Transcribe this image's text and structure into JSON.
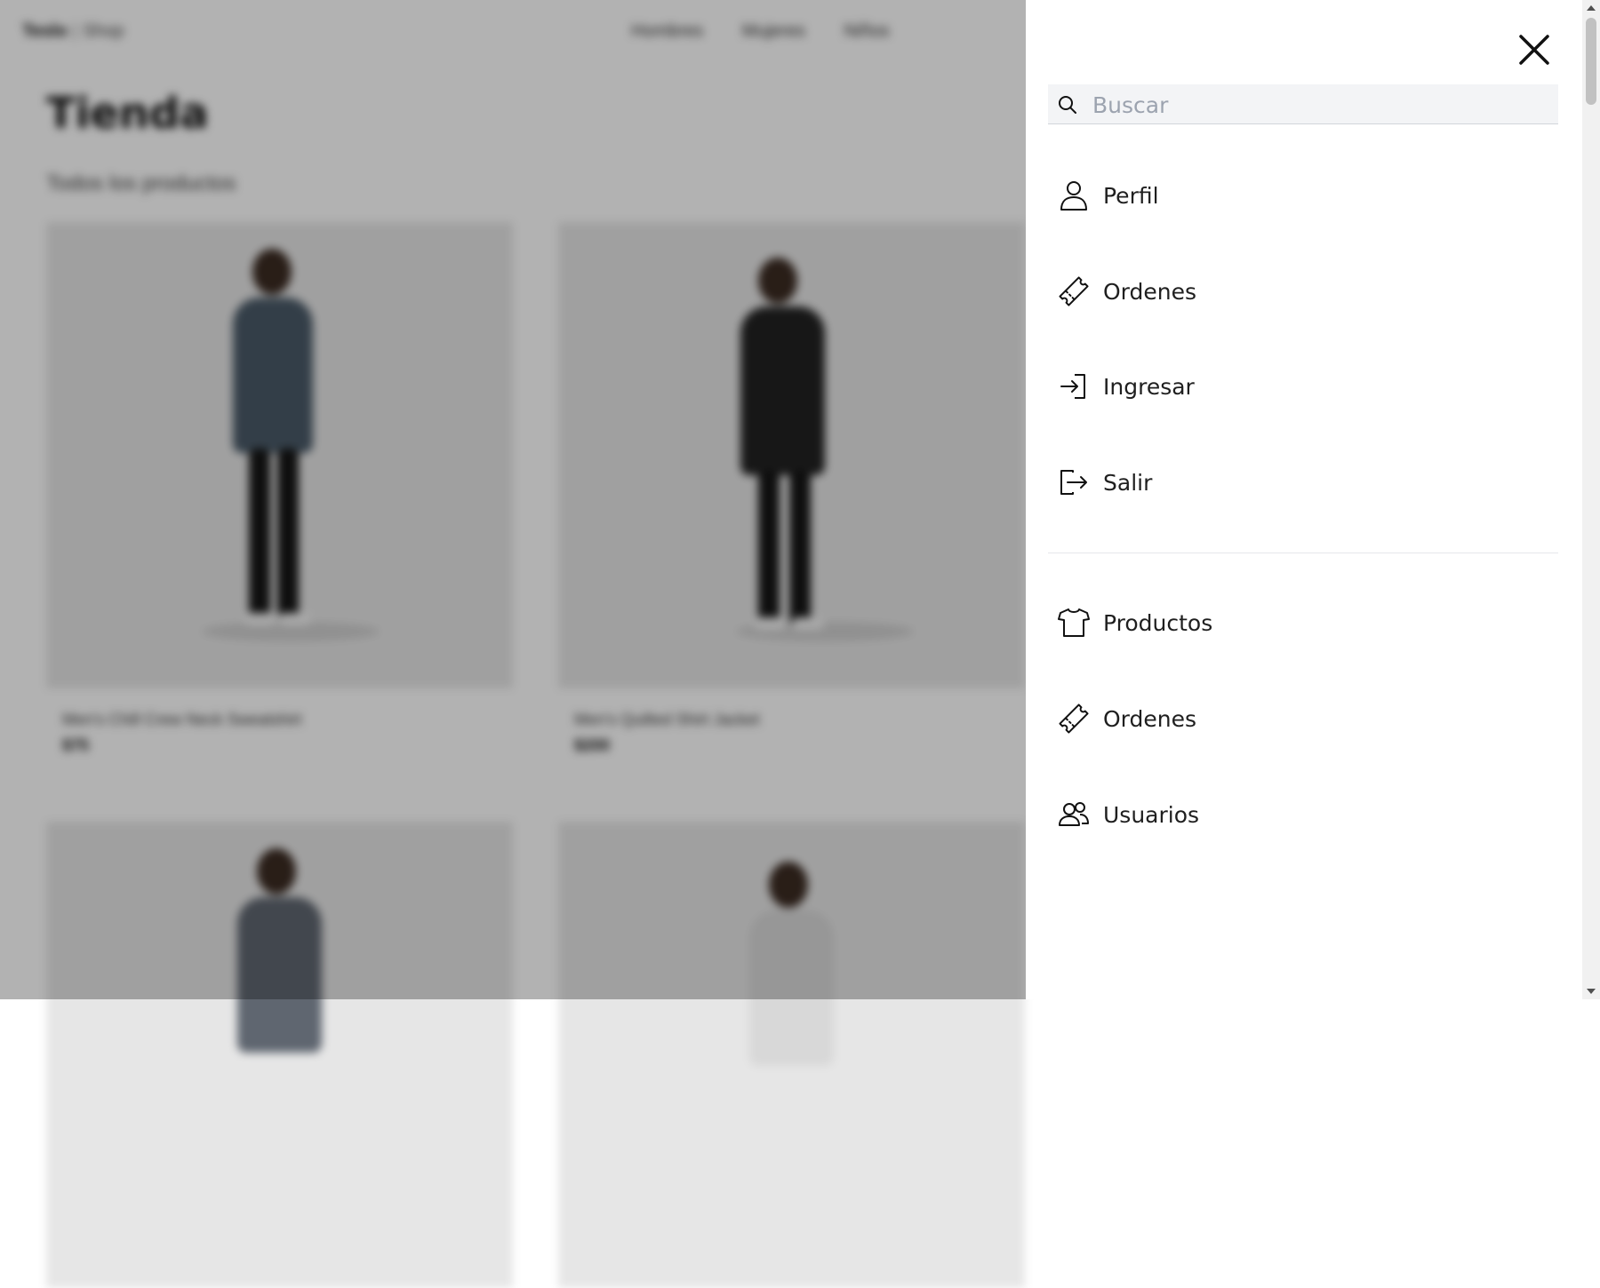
{
  "header": {
    "brand": "Teslo",
    "brand_suffix": "Shop",
    "separator": "|",
    "nav": [
      "Hombres",
      "Mujeres",
      "Niños"
    ]
  },
  "main": {
    "title": "Tienda",
    "subtitle": "Todos los productos",
    "products": [
      {
        "name": "Men's Chill Crew Neck Sweatshirt",
        "price": "$75",
        "torso_color": "#4a5a68"
      },
      {
        "name": "Men's Quilted Shirt Jacket",
        "price": "$200",
        "torso_color": "#222222"
      },
      {
        "name": "",
        "price": "",
        "torso_color": "#5f6670"
      },
      {
        "name": "",
        "price": "",
        "torso_color": "#d8d8d8"
      }
    ]
  },
  "side_menu": {
    "search_placeholder": "Buscar",
    "close_icon": "close-icon",
    "user_items": [
      {
        "label": "Perfil",
        "icon": "person-icon"
      },
      {
        "label": "Ordenes",
        "icon": "ticket-icon"
      },
      {
        "label": "Ingresar",
        "icon": "login-icon"
      },
      {
        "label": "Salir",
        "icon": "logout-icon"
      }
    ],
    "admin_items": [
      {
        "label": "Productos",
        "icon": "shirt-icon"
      },
      {
        "label": "Ordenes",
        "icon": "ticket-icon"
      },
      {
        "label": "Usuarios",
        "icon": "users-icon"
      }
    ]
  },
  "colors": {
    "overlay": "rgba(0,0,0,0.30)",
    "menu_background": "#ffffff",
    "search_background": "#f3f4f6"
  }
}
